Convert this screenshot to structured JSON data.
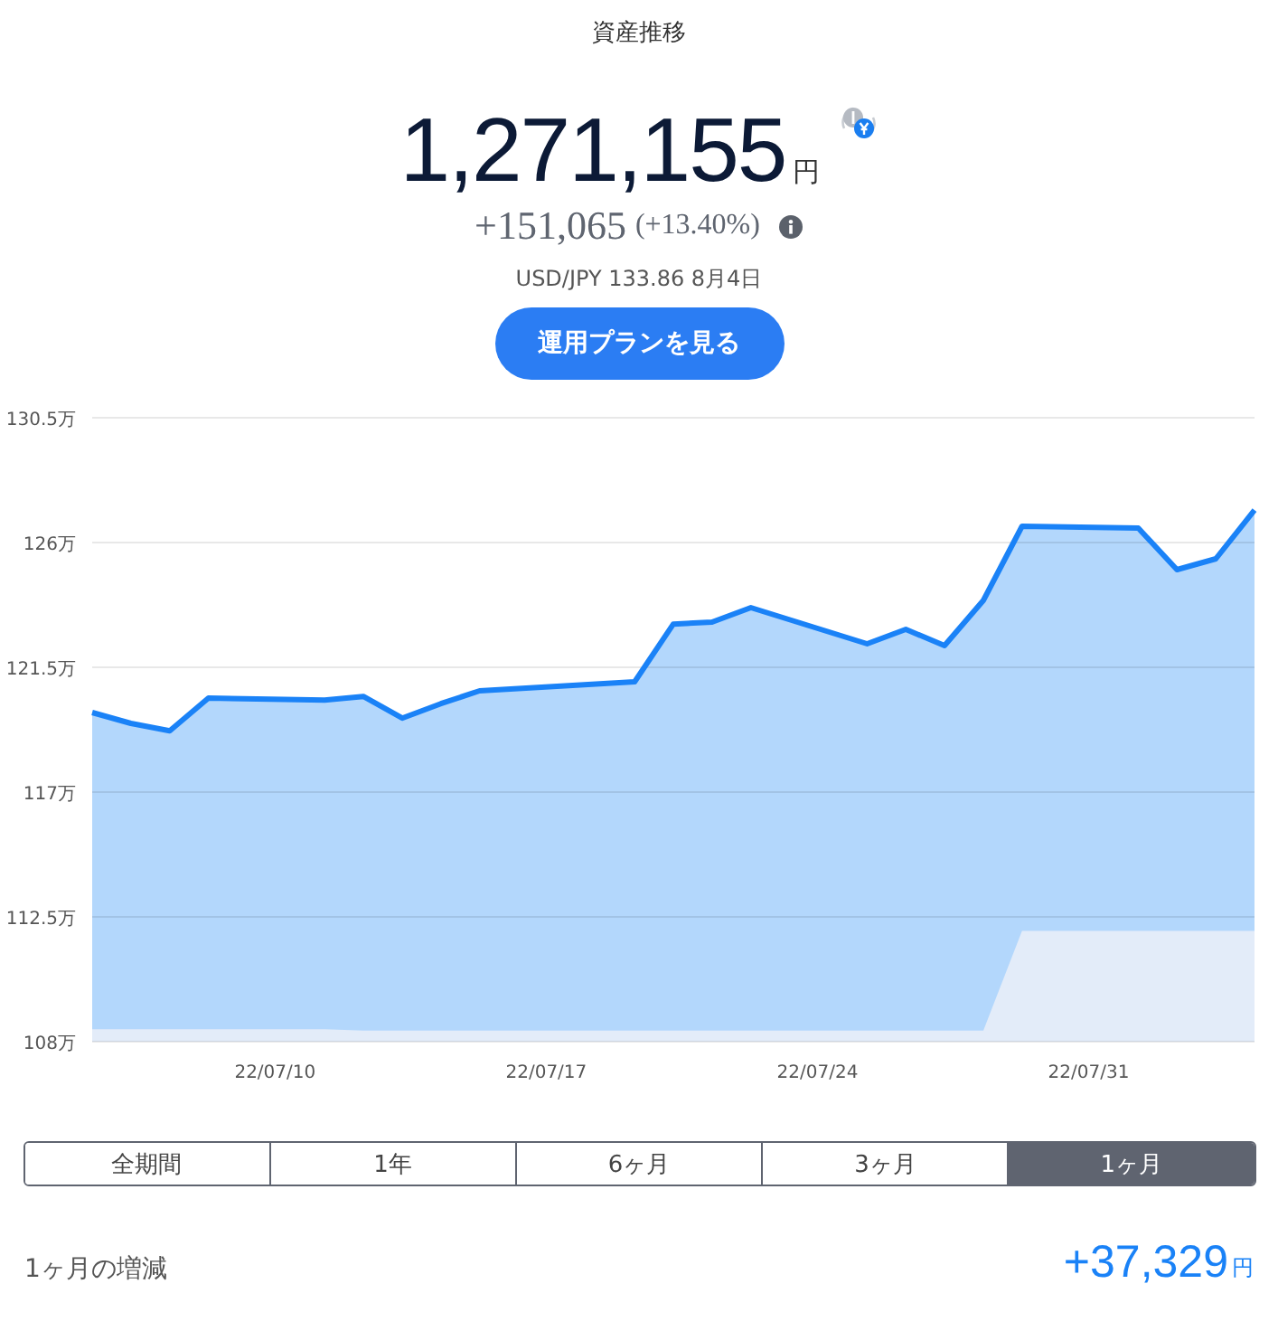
{
  "header": {
    "title": "資産推移"
  },
  "total": {
    "value": "1,271,155",
    "unit": "円"
  },
  "change": {
    "amount": "+151,065",
    "percent": "(+13.40%)"
  },
  "rate": "USD/JPY 133.86 8月4日",
  "plan_button": "運用プランを見る",
  "chart": {
    "chart_data": {
      "type": "area",
      "categories": [
        null,
        null,
        null,
        null,
        null,
        "22/07/10",
        null,
        null,
        null,
        null,
        null,
        null,
        "22/07/17",
        null,
        null,
        null,
        null,
        null,
        null,
        "22/07/24",
        null,
        null,
        null,
        null,
        null,
        null,
        "22/07/31",
        null,
        null,
        null,
        null
      ],
      "series": [
        {
          "color": "#1a82f7",
          "values": [
            119.87,
            119.48,
            119.21,
            120.39,
            null,
            null,
            120.32,
            120.45,
            119.67,
            120.19,
            120.65,
            null,
            null,
            null,
            120.98,
            123.06,
            123.13,
            123.65,
            null,
            null,
            122.35,
            122.87,
            122.28,
            123.91,
            126.59,
            null,
            null,
            126.52,
            125.02,
            125.41,
            127.17
          ]
        },
        {
          "color": "#e3ecf9",
          "values": [
            108.45,
            108.45,
            108.45,
            108.45,
            null,
            null,
            108.45,
            108.4,
            108.4,
            108.4,
            108.4,
            null,
            null,
            null,
            108.4,
            108.4,
            108.4,
            108.4,
            null,
            null,
            108.4,
            108.4,
            108.4,
            108.4,
            112.0,
            null,
            null,
            112.0,
            112.0,
            112.0,
            112.0
          ]
        }
      ],
      "ylim": [
        108,
        130.5
      ],
      "grid": true,
      "yticks": [
        {
          "value": 130.5,
          "label": "130.5万"
        },
        {
          "value": 126,
          "label": "126万"
        },
        {
          "value": 121.5,
          "label": "121.5万"
        },
        {
          "value": 117,
          "label": "117万"
        },
        {
          "value": 112.5,
          "label": "112.5万"
        },
        {
          "value": 108,
          "label": "108万"
        }
      ]
    }
  },
  "periods": [
    {
      "label": "全期間",
      "selected": false
    },
    {
      "label": "1年",
      "selected": false
    },
    {
      "label": "6ヶ月",
      "selected": false
    },
    {
      "label": "3ヶ月",
      "selected": false
    },
    {
      "label": "1ヶ月",
      "selected": true
    }
  ],
  "period_change": {
    "label": "1ヶ月の増減",
    "value": "+37,329",
    "unit": "円"
  }
}
